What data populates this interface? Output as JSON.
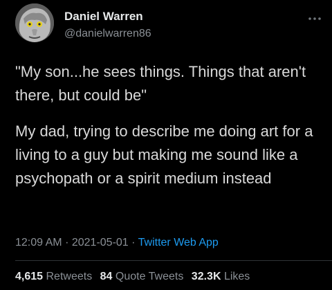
{
  "author": {
    "display_name": "Daniel Warren",
    "handle": "@danielwarren86",
    "avatar_icon": "profile-photo"
  },
  "tweet": {
    "quote_line": "\"My son...he sees things. Things that aren't there, but could be\"",
    "body": "My dad, trying to describe me doing art for a living to a guy but making me sound like a psychopath or a spirit medium instead",
    "time": "12:09 AM",
    "date": "2021-05-01",
    "separator": "·",
    "source": "Twitter Web App"
  },
  "stats": {
    "retweets_count": "4,615",
    "retweets_label": "Retweets",
    "quote_tweets_count": "84",
    "quote_tweets_label": "Quote Tweets",
    "likes_count": "32.3K",
    "likes_label": "Likes"
  },
  "menu": {
    "more_icon": "more-horizontal-icon"
  },
  "colors": {
    "background": "#000000",
    "primary_text": "#e7e9ea",
    "secondary_text": "#8b9096",
    "link": "#1d9bf0"
  }
}
